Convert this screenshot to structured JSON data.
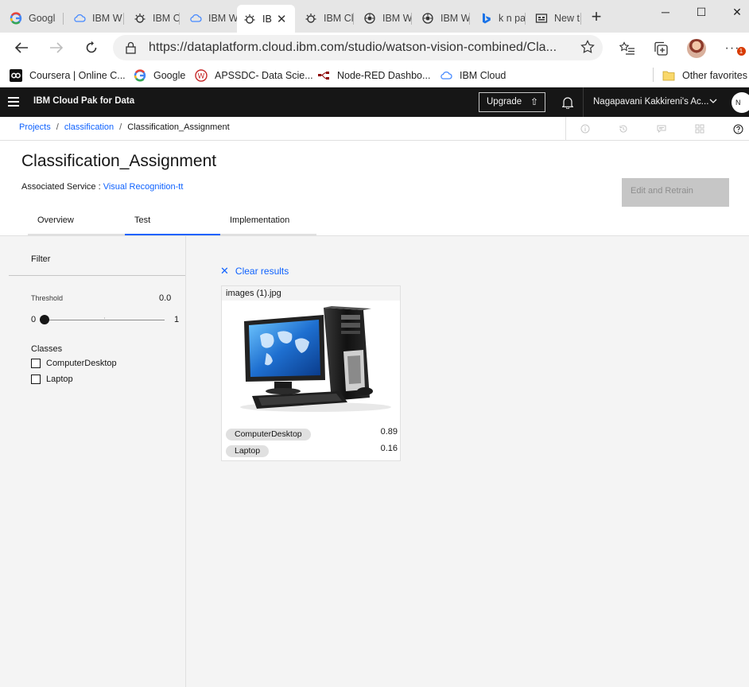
{
  "browser": {
    "tabs": [
      {
        "icon": "google-icon",
        "title": "Googl"
      },
      {
        "icon": "ibm-cloud-icon",
        "title": "IBM W"
      },
      {
        "icon": "watson-icon",
        "title": "IBM Cl"
      },
      {
        "icon": "ibm-cloud-icon",
        "title": "IBM W"
      },
      {
        "icon": "watson-icon",
        "title": "IB"
      },
      {
        "icon": "watson-icon",
        "title": "IBM Cl"
      },
      {
        "icon": "watson-studio-icon",
        "title": "IBM W"
      },
      {
        "icon": "watson-studio-icon",
        "title": "IBM W"
      },
      {
        "icon": "bing-icon",
        "title": "k n pa"
      },
      {
        "icon": "newtab-icon",
        "title": "New t"
      }
    ],
    "active_tab_index": 4,
    "url": "https://dataplatform.cloud.ibm.com/studio/watson-vision-combined/Cla...",
    "notification_badge": "1",
    "favorites": [
      {
        "icon": "coursera-icon",
        "label": "Coursera | Online C..."
      },
      {
        "icon": "google-icon",
        "label": "Google"
      },
      {
        "icon": "apssdc-icon",
        "label": "APSSDC- Data Scie..."
      },
      {
        "icon": "node-red-icon",
        "label": "Node-RED Dashbo..."
      },
      {
        "icon": "ibm-cloud-icon",
        "label": "IBM Cloud"
      }
    ],
    "other_favorites": "Other favorites"
  },
  "ibm_header": {
    "product": "IBM Cloud Pak for Data",
    "upgrade_label": "Upgrade",
    "account": "Nagapavani Kakkireni's Ac...",
    "user_initial": "N"
  },
  "breadcrumb": {
    "projects": "Projects",
    "project": "classification",
    "current": "Classification_Assignment"
  },
  "page": {
    "title": "Classification_Assignment",
    "assoc_label": "Associated Service : ",
    "assoc_service": "Visual Recognition-tt",
    "retrain_label": "Edit and Retrain",
    "tabs": [
      "Overview",
      "Test",
      "Implementation"
    ],
    "active_tab": "Test"
  },
  "filter": {
    "title": "Filter",
    "threshold_label": "Threshold",
    "threshold_value": "0.0",
    "threshold_fraction": 0.0,
    "min": "0",
    "max": "1",
    "classes_title": "Classes",
    "classes": [
      "ComputerDesktop",
      "Laptop"
    ]
  },
  "results": {
    "clear_label": "Clear results",
    "card": {
      "filename": "images (1).jpg",
      "image_icon": "desktop-computer-image",
      "scores": [
        {
          "class": "ComputerDesktop",
          "score": "0.89"
        },
        {
          "class": "Laptop",
          "score": "0.16"
        }
      ]
    }
  },
  "colors": {
    "ibm_blue": "#0f62fe",
    "header_bg": "#161616",
    "panel_bg": "#f4f4f4",
    "disabled_button": "#c6c6c6"
  }
}
